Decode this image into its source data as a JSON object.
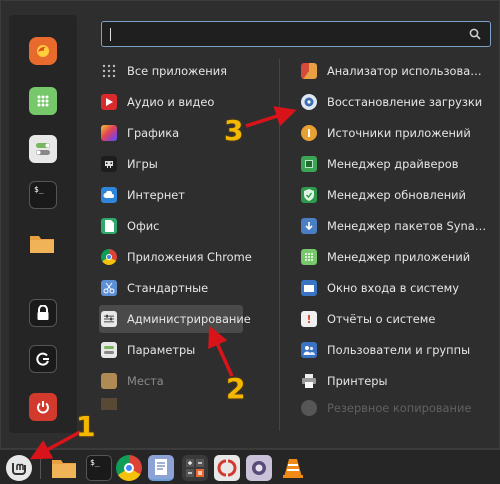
{
  "search": {
    "value": "",
    "placeholder": ""
  },
  "favorites": [
    {
      "name": "firefox-icon",
      "color": "#e86b2d"
    },
    {
      "name": "software-manager-icon",
      "color": "#77c86a"
    },
    {
      "name": "settings-toggle-icon",
      "color": "#7ab65e"
    },
    {
      "name": "terminal-icon",
      "color": "#1a1a1a"
    },
    {
      "name": "folder-icon",
      "color": "#e8a043"
    },
    {
      "name": "lock-icon",
      "color": "#1a1a1a"
    },
    {
      "name": "logout-icon",
      "color": "#1a1a1a"
    },
    {
      "name": "power-icon",
      "color": "#d23a2e"
    }
  ],
  "categories": [
    {
      "label": "Все приложения",
      "icon": "grid-icon"
    },
    {
      "label": "Аудио и видео",
      "icon": "play-icon"
    },
    {
      "label": "Графика",
      "icon": "graphics-icon"
    },
    {
      "label": "Игры",
      "icon": "games-icon"
    },
    {
      "label": "Интернет",
      "icon": "cloud-icon"
    },
    {
      "label": "Офис",
      "icon": "office-icon"
    },
    {
      "label": "Приложения Chrome",
      "icon": "chrome-icon"
    },
    {
      "label": "Стандартные",
      "icon": "scissors-icon"
    },
    {
      "label": "Администрирование",
      "icon": "admin-icon"
    },
    {
      "label": "Параметры",
      "icon": "parameters-icon"
    },
    {
      "label": "Места",
      "icon": "places-folder-icon"
    }
  ],
  "apps": [
    {
      "label": "Анализатор использова…",
      "icon": "disk-analyzer-icon"
    },
    {
      "label": "Восстановление загрузки",
      "icon": "boot-repair-icon"
    },
    {
      "label": "Источники приложений",
      "icon": "sources-icon"
    },
    {
      "label": "Менеджер драйверов",
      "icon": "driver-manager-icon"
    },
    {
      "label": "Менеджер обновлений",
      "icon": "update-manager-icon"
    },
    {
      "label": "Менеджер пакетов Syna…",
      "icon": "synaptic-icon"
    },
    {
      "label": "Менеджер приложений",
      "icon": "software-manager-icon"
    },
    {
      "label": "Окно входа в систему",
      "icon": "login-window-icon"
    },
    {
      "label": "Отчёты о системе",
      "icon": "system-reports-icon"
    },
    {
      "label": "Пользователи и группы",
      "icon": "users-groups-icon"
    },
    {
      "label": "Принтеры",
      "icon": "printer-icon"
    },
    {
      "label": "Резервное копирование",
      "icon": "backup-icon"
    }
  ],
  "annotations": [
    "1",
    "2",
    "3"
  ],
  "colors": {
    "annotation": "#f5b800",
    "arrow": "#d8141a",
    "search_border": "#7fa1c8",
    "highlight": "#4a4a4a"
  }
}
